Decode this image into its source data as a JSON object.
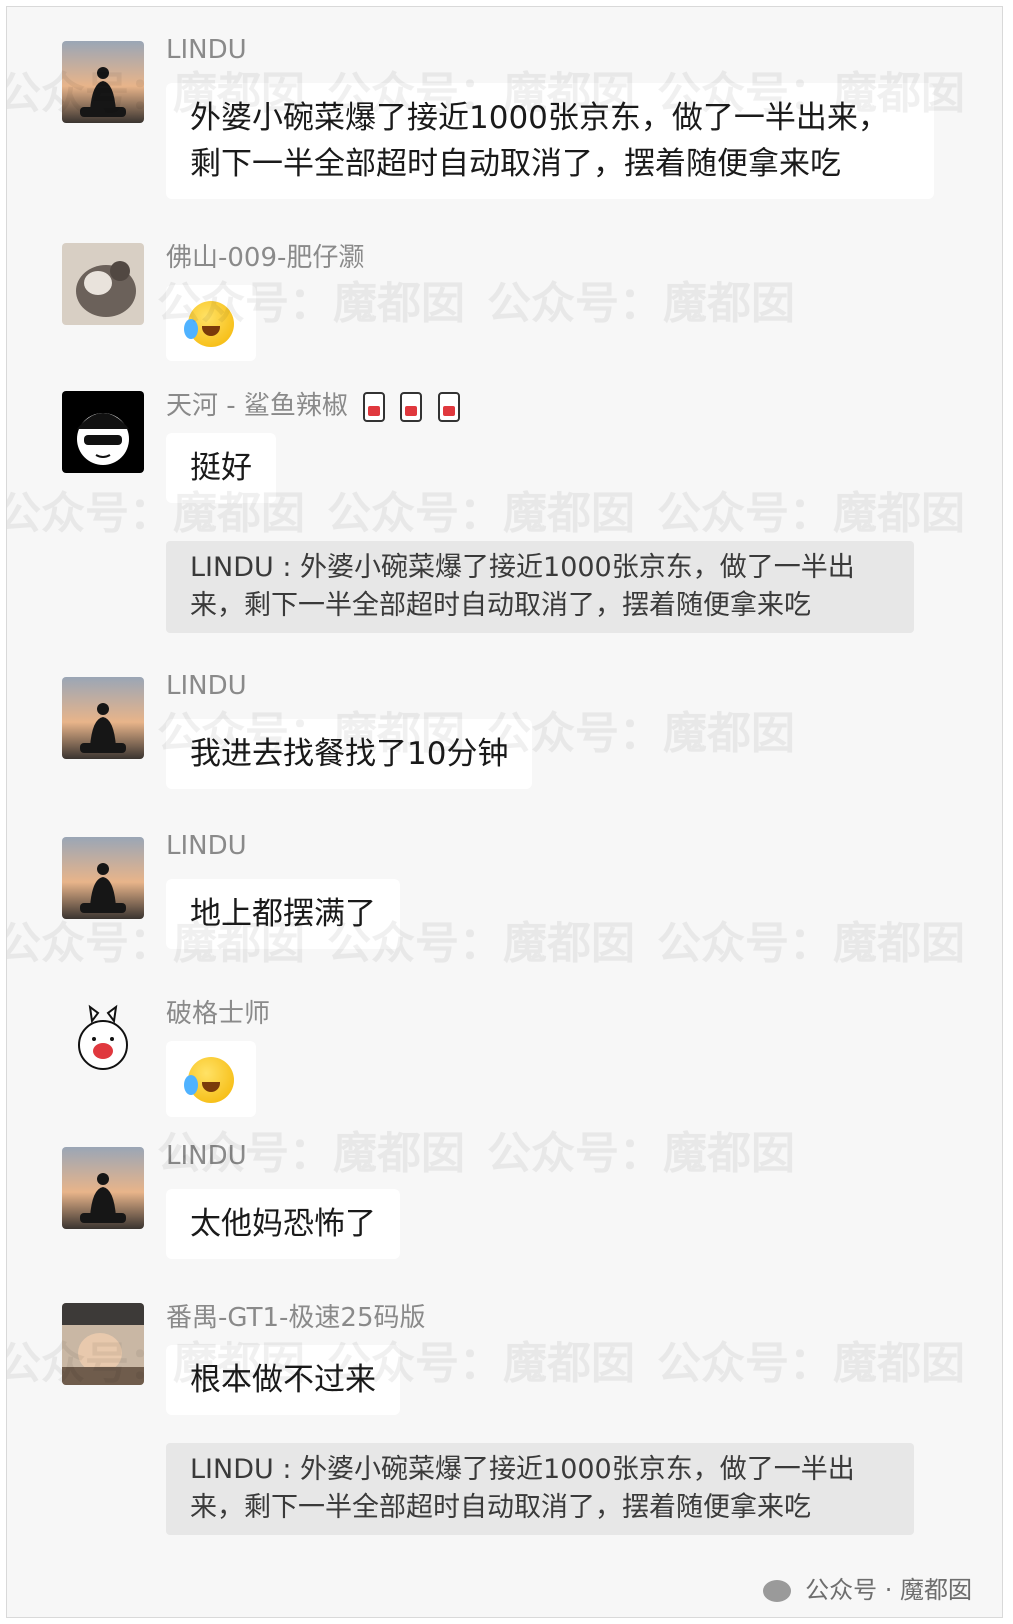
{
  "messages": [
    {
      "sender": "LINDU",
      "type": "text",
      "text": "外婆小碗菜爆了接近1000张京东，做了一半出来，剩下一半全部超时自动取消了，摆着随便拿来吃"
    },
    {
      "sender": "佛山-009-肥仔灏",
      "type": "emoji",
      "emoji": "crying-laughing-emoji"
    },
    {
      "sender": "天河 - 鲨鱼辣椒",
      "type": "text",
      "text": "挺好",
      "quote": "LINDU : 外婆小碗菜爆了接近1000张京东，做了一半出来，剩下一半全部超时自动取消了，摆着随便拿来吃"
    },
    {
      "sender": "LINDU",
      "type": "text",
      "text": "我进去找餐找了10分钟"
    },
    {
      "sender": "LINDU",
      "type": "text",
      "text": "地上都摆满了"
    },
    {
      "sender": "破格士师",
      "type": "emoji",
      "emoji": "crying-laughing-emoji"
    },
    {
      "sender": "LINDU",
      "type": "text",
      "text": "太他妈恐怖了"
    },
    {
      "sender": "番禺-GT1-极速25码版",
      "type": "text",
      "text": "根本做不过来",
      "quote": "LINDU : 外婆小碗菜爆了接近1000张京东，做了一半出来，剩下一半全部超时自动取消了，摆着随便拿来吃"
    }
  ],
  "watermark": {
    "text": "公众号：魔都囡",
    "footer": "公众号 · 魔都囡"
  },
  "colors": {
    "bubble": "#ffffff",
    "background": "#f7f7f7",
    "quote_bg": "#e7e7e7",
    "sender": "#8a8a8a"
  }
}
